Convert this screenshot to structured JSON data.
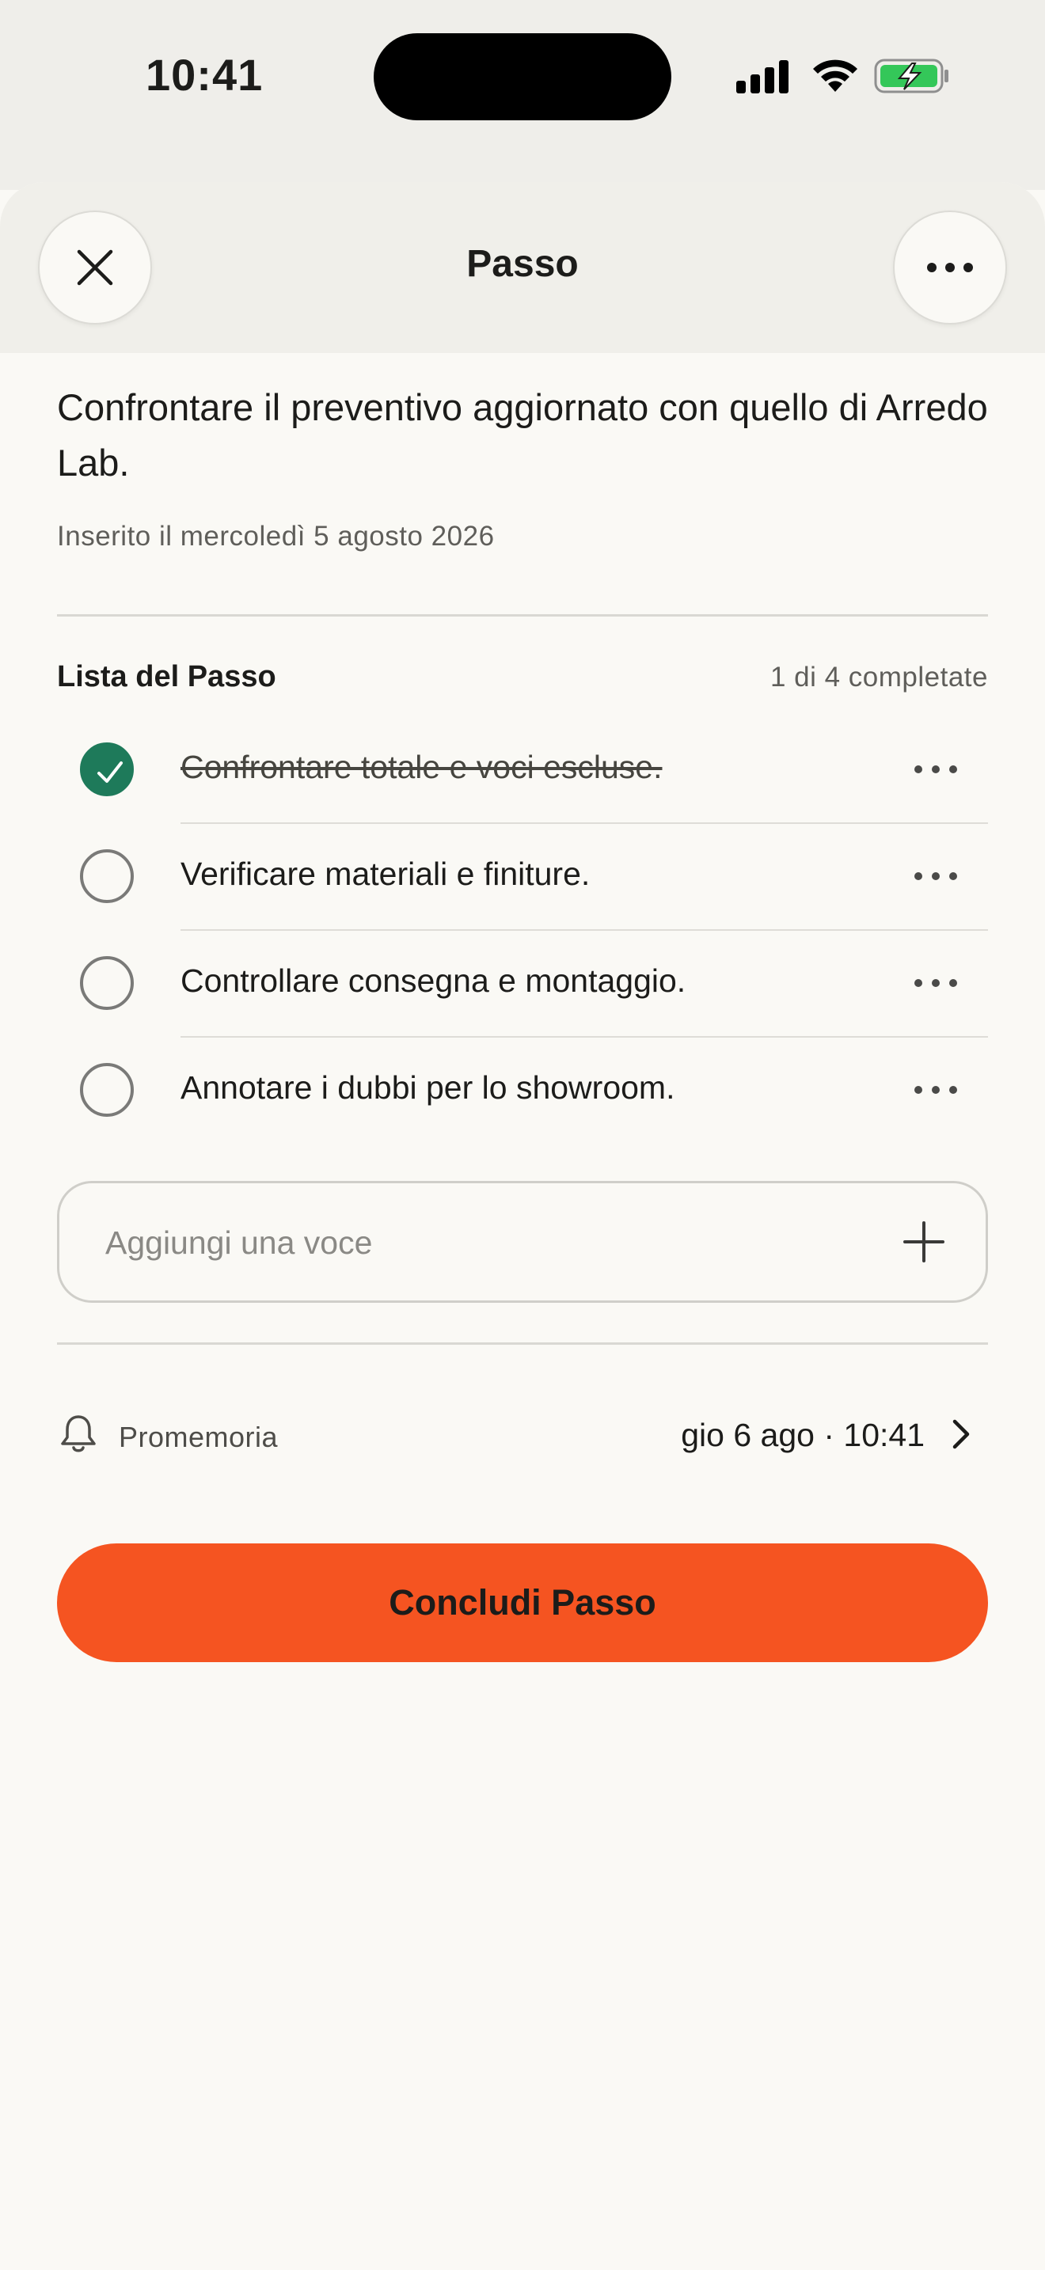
{
  "status_bar": {
    "time": "10:41"
  },
  "header": {
    "title": "Passo"
  },
  "step": {
    "text": "Confrontare il preventivo aggiornato con quello di Arredo Lab.",
    "date": "Inserito il mercoledì 5 agosto 2026"
  },
  "checklist": {
    "title": "Lista del Passo",
    "count": "1 di 4 completate",
    "items": [
      {
        "label": "Confrontare totale e voci escluse.",
        "done": true
      },
      {
        "label": "Verificare materiali e finiture.",
        "done": false
      },
      {
        "label": "Controllare consegna e montaggio.",
        "done": false
      },
      {
        "label": "Annotare i dubbi per lo showroom.",
        "done": false
      }
    ]
  },
  "add_item": {
    "placeholder": "Aggiungi una voce",
    "value": ""
  },
  "reminder": {
    "label": "Promemoria",
    "value": "gio 6 ago · 10:41"
  },
  "cta": {
    "label": "Concludi Passo"
  },
  "colors": {
    "accent": "#f55421",
    "done": "#1e7a5a",
    "battery": "#34c759"
  },
  "icons": [
    "close-icon",
    "more-icon",
    "checkmark-icon",
    "plus-icon",
    "bell-icon",
    "chevron-right-icon",
    "signal-icon",
    "wifi-icon",
    "battery-icon"
  ]
}
